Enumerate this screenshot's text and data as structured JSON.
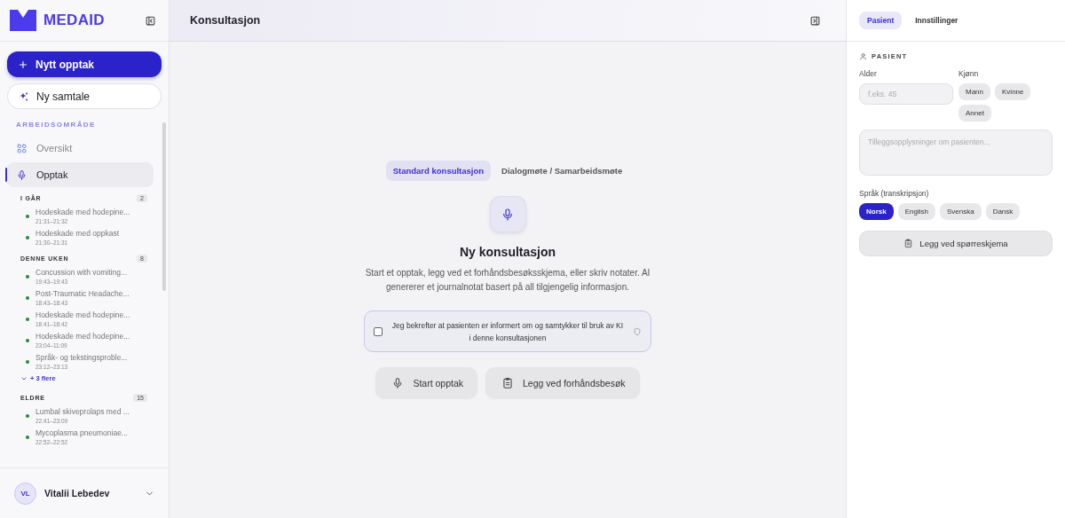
{
  "sidebar": {
    "logo": "MEDAID",
    "new_recording": {
      "label": "Nytt opptak"
    },
    "new_chat": {
      "label": "Ny samtale"
    },
    "section_label": "ARBEIDSOMRÅDE",
    "nav": [
      {
        "label": "Oversikt",
        "selected": false
      },
      {
        "label": "Opptak",
        "selected": true
      }
    ],
    "groups": [
      {
        "title": "I GÅR",
        "count": "2",
        "items": [
          {
            "title": "Hodeskade med hodepine...",
            "time": "21:31–21:32"
          },
          {
            "title": "Hodeskade med oppkast",
            "time": "21:30–21:31"
          }
        ]
      },
      {
        "title": "DENNE UKEN",
        "count": "8",
        "items": [
          {
            "title": "Concussion with vomiting...",
            "time": "19:43–19:43"
          },
          {
            "title": "Post-Traumatic Headache...",
            "time": "18:43–18:43"
          },
          {
            "title": "Hodeskade med hodepine...",
            "time": "18:41–18:42"
          },
          {
            "title": "Hodeskade med hodepine...",
            "time": "23:04–11:09"
          },
          {
            "title": "Språk- og tekstingsproble...",
            "time": "23:12–23:13"
          }
        ],
        "more": "+ 3 flere"
      },
      {
        "title": "ELDRE",
        "count": "15",
        "items": [
          {
            "title": "Lumbal skiveprolaps med ...",
            "time": "22:41–23:09"
          },
          {
            "title": "Mycoplasma pneumoniae...",
            "time": "22:52–22:52"
          }
        ]
      }
    ],
    "user": {
      "initials": "VL",
      "name": "Vitalii Lebedev"
    }
  },
  "header": {
    "title": "Konsultasjon"
  },
  "main": {
    "modes": [
      {
        "label": "Standard konsultasjon",
        "selected": true
      },
      {
        "label": "Dialogmøte / Samarbeidsmøte",
        "selected": false
      }
    ],
    "heading": "Ny konsultasjon",
    "description": "Start et opptak, legg ved et forhåndsbesøksskjema, eller skriv notater. AI genererer et journalnotat basert på all tilgjengelig informasjon.",
    "consent": {
      "label": "Jeg bekrefter at pasienten er informert om og samtykker til bruk av KI i denne konsultasjonen",
      "checked": false
    },
    "buttons": [
      {
        "label": "Start opptak"
      },
      {
        "label": "Legg ved forhåndsbesøk"
      }
    ]
  },
  "panel": {
    "tabs": [
      {
        "label": "Pasient",
        "selected": true
      },
      {
        "label": "Innstillinger",
        "selected": false
      }
    ],
    "section": "PASIENT",
    "age": {
      "label": "Alder",
      "placeholder": "f.eks. 45"
    },
    "gender": {
      "label": "Kjønn",
      "options": [
        {
          "label": "Mann",
          "selected": false
        },
        {
          "label": "Kvinne",
          "selected": false
        },
        {
          "label": "Annet",
          "selected": false
        }
      ]
    },
    "notes": {
      "placeholder": "Tilleggsopplysninger om pasienten..."
    },
    "language": {
      "label": "Språk (transkripsjon)",
      "options": [
        {
          "label": "Norsk",
          "selected": true
        },
        {
          "label": "English",
          "selected": false
        },
        {
          "label": "Svenska",
          "selected": false
        },
        {
          "label": "Dansk",
          "selected": false
        }
      ]
    },
    "attach": {
      "label": "Legg ved spørreskjema"
    }
  }
}
